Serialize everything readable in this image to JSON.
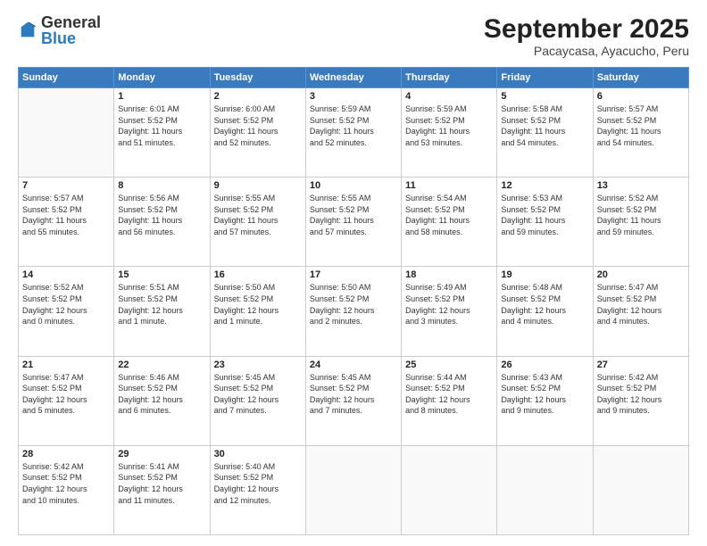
{
  "logo": {
    "general": "General",
    "blue": "Blue"
  },
  "title": {
    "month": "September 2025",
    "location": "Pacaycasa, Ayacucho, Peru"
  },
  "weekdays": [
    "Sunday",
    "Monday",
    "Tuesday",
    "Wednesday",
    "Thursday",
    "Friday",
    "Saturday"
  ],
  "weeks": [
    [
      {
        "day": "",
        "info": ""
      },
      {
        "day": "1",
        "info": "Sunrise: 6:01 AM\nSunset: 5:52 PM\nDaylight: 11 hours\nand 51 minutes."
      },
      {
        "day": "2",
        "info": "Sunrise: 6:00 AM\nSunset: 5:52 PM\nDaylight: 11 hours\nand 52 minutes."
      },
      {
        "day": "3",
        "info": "Sunrise: 5:59 AM\nSunset: 5:52 PM\nDaylight: 11 hours\nand 52 minutes."
      },
      {
        "day": "4",
        "info": "Sunrise: 5:59 AM\nSunset: 5:52 PM\nDaylight: 11 hours\nand 53 minutes."
      },
      {
        "day": "5",
        "info": "Sunrise: 5:58 AM\nSunset: 5:52 PM\nDaylight: 11 hours\nand 54 minutes."
      },
      {
        "day": "6",
        "info": "Sunrise: 5:57 AM\nSunset: 5:52 PM\nDaylight: 11 hours\nand 54 minutes."
      }
    ],
    [
      {
        "day": "7",
        "info": "Sunrise: 5:57 AM\nSunset: 5:52 PM\nDaylight: 11 hours\nand 55 minutes."
      },
      {
        "day": "8",
        "info": "Sunrise: 5:56 AM\nSunset: 5:52 PM\nDaylight: 11 hours\nand 56 minutes."
      },
      {
        "day": "9",
        "info": "Sunrise: 5:55 AM\nSunset: 5:52 PM\nDaylight: 11 hours\nand 57 minutes."
      },
      {
        "day": "10",
        "info": "Sunrise: 5:55 AM\nSunset: 5:52 PM\nDaylight: 11 hours\nand 57 minutes."
      },
      {
        "day": "11",
        "info": "Sunrise: 5:54 AM\nSunset: 5:52 PM\nDaylight: 11 hours\nand 58 minutes."
      },
      {
        "day": "12",
        "info": "Sunrise: 5:53 AM\nSunset: 5:52 PM\nDaylight: 11 hours\nand 59 minutes."
      },
      {
        "day": "13",
        "info": "Sunrise: 5:52 AM\nSunset: 5:52 PM\nDaylight: 11 hours\nand 59 minutes."
      }
    ],
    [
      {
        "day": "14",
        "info": "Sunrise: 5:52 AM\nSunset: 5:52 PM\nDaylight: 12 hours\nand 0 minutes."
      },
      {
        "day": "15",
        "info": "Sunrise: 5:51 AM\nSunset: 5:52 PM\nDaylight: 12 hours\nand 1 minute."
      },
      {
        "day": "16",
        "info": "Sunrise: 5:50 AM\nSunset: 5:52 PM\nDaylight: 12 hours\nand 1 minute."
      },
      {
        "day": "17",
        "info": "Sunrise: 5:50 AM\nSunset: 5:52 PM\nDaylight: 12 hours\nand 2 minutes."
      },
      {
        "day": "18",
        "info": "Sunrise: 5:49 AM\nSunset: 5:52 PM\nDaylight: 12 hours\nand 3 minutes."
      },
      {
        "day": "19",
        "info": "Sunrise: 5:48 AM\nSunset: 5:52 PM\nDaylight: 12 hours\nand 4 minutes."
      },
      {
        "day": "20",
        "info": "Sunrise: 5:47 AM\nSunset: 5:52 PM\nDaylight: 12 hours\nand 4 minutes."
      }
    ],
    [
      {
        "day": "21",
        "info": "Sunrise: 5:47 AM\nSunset: 5:52 PM\nDaylight: 12 hours\nand 5 minutes."
      },
      {
        "day": "22",
        "info": "Sunrise: 5:46 AM\nSunset: 5:52 PM\nDaylight: 12 hours\nand 6 minutes."
      },
      {
        "day": "23",
        "info": "Sunrise: 5:45 AM\nSunset: 5:52 PM\nDaylight: 12 hours\nand 7 minutes."
      },
      {
        "day": "24",
        "info": "Sunrise: 5:45 AM\nSunset: 5:52 PM\nDaylight: 12 hours\nand 7 minutes."
      },
      {
        "day": "25",
        "info": "Sunrise: 5:44 AM\nSunset: 5:52 PM\nDaylight: 12 hours\nand 8 minutes."
      },
      {
        "day": "26",
        "info": "Sunrise: 5:43 AM\nSunset: 5:52 PM\nDaylight: 12 hours\nand 9 minutes."
      },
      {
        "day": "27",
        "info": "Sunrise: 5:42 AM\nSunset: 5:52 PM\nDaylight: 12 hours\nand 9 minutes."
      }
    ],
    [
      {
        "day": "28",
        "info": "Sunrise: 5:42 AM\nSunset: 5:52 PM\nDaylight: 12 hours\nand 10 minutes."
      },
      {
        "day": "29",
        "info": "Sunrise: 5:41 AM\nSunset: 5:52 PM\nDaylight: 12 hours\nand 11 minutes."
      },
      {
        "day": "30",
        "info": "Sunrise: 5:40 AM\nSunset: 5:52 PM\nDaylight: 12 hours\nand 12 minutes."
      },
      {
        "day": "",
        "info": ""
      },
      {
        "day": "",
        "info": ""
      },
      {
        "day": "",
        "info": ""
      },
      {
        "day": "",
        "info": ""
      }
    ]
  ]
}
